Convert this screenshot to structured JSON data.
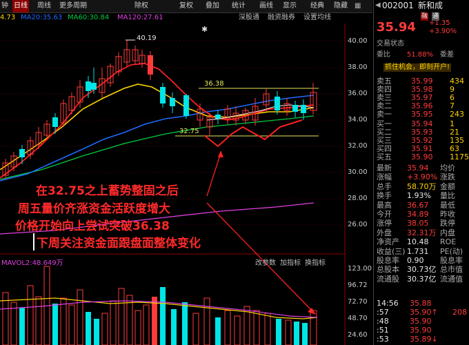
{
  "toolbar": {
    "items": [
      "钟",
      "日线",
      "周线",
      "更多周期",
      "除权",
      "复权",
      "叠加",
      "统计",
      "画线",
      "显示",
      "经典",
      "隐藏"
    ],
    "selected": "日线"
  },
  "ma": {
    "value_prefix": "4.73",
    "ma20": "MA20:35.63",
    "ma60": "MA60:30.84",
    "ma120": "MA120:27.61",
    "sub_tabs": [
      "深股通",
      "融资融券",
      "设置均线"
    ]
  },
  "price_axis": [
    "40.00",
    "38.00",
    "36.00",
    "34.00",
    "32.00",
    "30.00",
    "28.00",
    "26.00"
  ],
  "annotations": {
    "high": "40.19",
    "resistance": "36.38",
    "support": "32.75",
    "line1": "在32.75之上蓄势整固之后",
    "line2": "周五量价齐涨资金活跃度增大",
    "line3": "价格开始向上尝试突破36.38",
    "line4": "下周关注资金面跟盘面整体变化"
  },
  "volume": {
    "label": "MAVOL2:48.649万",
    "tabs": [
      "改参数",
      "加指标",
      "换指标"
    ],
    "axis": [
      "123.00",
      "96.72",
      "72.70",
      "48.70",
      "24.60"
    ]
  },
  "quote": {
    "code": "002001",
    "name": "新和成",
    "tags": [
      "融",
      "通"
    ],
    "price": "35.94",
    "change": "+1.35",
    "change_pct": "+3.90%",
    "status_label": "交易状态",
    "weibi_label": "委比",
    "weibi": "51.88%",
    "weicha_label": "委差",
    "promo": "抓住机会，即刻开户!",
    "sells": [
      {
        "label": "卖五",
        "price": "35.99",
        "vol": "434"
      },
      {
        "label": "卖四",
        "price": "35.98",
        "vol": "9"
      },
      {
        "label": "卖三",
        "price": "35.97",
        "vol": "6"
      },
      {
        "label": "卖二",
        "price": "35.96",
        "vol": "7"
      },
      {
        "label": "卖一",
        "price": "35.95",
        "vol": "243"
      }
    ],
    "buys": [
      {
        "label": "买一",
        "price": "35.94",
        "vol": "1"
      },
      {
        "label": "买二",
        "price": "35.93",
        "vol": "21"
      },
      {
        "label": "买三",
        "price": "35.92",
        "vol": "135"
      },
      {
        "label": "买四",
        "price": "35.91",
        "vol": "63"
      },
      {
        "label": "买五",
        "price": "35.90",
        "vol": "1175"
      }
    ],
    "stats": [
      {
        "l": "最新",
        "v": "35.94",
        "vc": "red",
        "l2": "均价"
      },
      {
        "l": "涨幅",
        "v": "+3.90%",
        "vc": "red",
        "l2": "涨跌"
      },
      {
        "l": "总手",
        "v": "58.70万",
        "vc": "yel",
        "l2": "金额"
      },
      {
        "l": "换手",
        "v": "1.93%",
        "vc": "wht",
        "l2": "量比"
      },
      {
        "l": "最高",
        "v": "36.67",
        "vc": "red",
        "l2": "最低"
      },
      {
        "l": "今开",
        "v": "34.89",
        "vc": "red",
        "l2": "昨收"
      },
      {
        "l": "涨停",
        "v": "38.05",
        "vc": "red",
        "l2": "跌停"
      },
      {
        "l": "外盘",
        "v": "32.31万",
        "vc": "red",
        "l2": "内盘"
      },
      {
        "l": "净资产",
        "v": "10.48",
        "vc": "wht",
        "l2": "ROE"
      },
      {
        "l": "收益(三)",
        "v": "1.731",
        "vc": "wht",
        "l2": "PE(动)"
      },
      {
        "l": "股息率",
        "v": "0.90",
        "vc": "wht",
        "l2": "股息率"
      },
      {
        "l": "总股本",
        "v": "30.73亿",
        "vc": "wht",
        "l2": "总市值"
      },
      {
        "l": "流通股",
        "v": "30.37亿",
        "vc": "wht",
        "l2": "流通值"
      }
    ],
    "ticks": [
      {
        "t": "14:56",
        "p": "35.88",
        "pc": "red",
        "v": "",
        "vc": "red"
      },
      {
        "t": ":57",
        "p": "35.90",
        "pc": "red",
        "v": "208",
        "vc": "red",
        "arrow": "↑"
      },
      {
        "t": ":48",
        "p": "35.90",
        "pc": "red",
        "v": "",
        "vc": "red"
      },
      {
        "t": ":51",
        "p": "35.90",
        "pc": "red",
        "v": "",
        "vc": "red"
      },
      {
        "t": ":53",
        "p": "35.89",
        "pc": "red",
        "v": "",
        "vc": "grn",
        "arrow": "↓"
      }
    ]
  },
  "colors": {
    "up": "#ff3b3b",
    "down": "#00e5e5",
    "ma5": "#ffffff",
    "ma10": "#ffd400",
    "ma20": "#ff2020",
    "ma60": "#1e6bff",
    "ma120": "#00d040",
    "ma250": "#e040e0"
  }
}
